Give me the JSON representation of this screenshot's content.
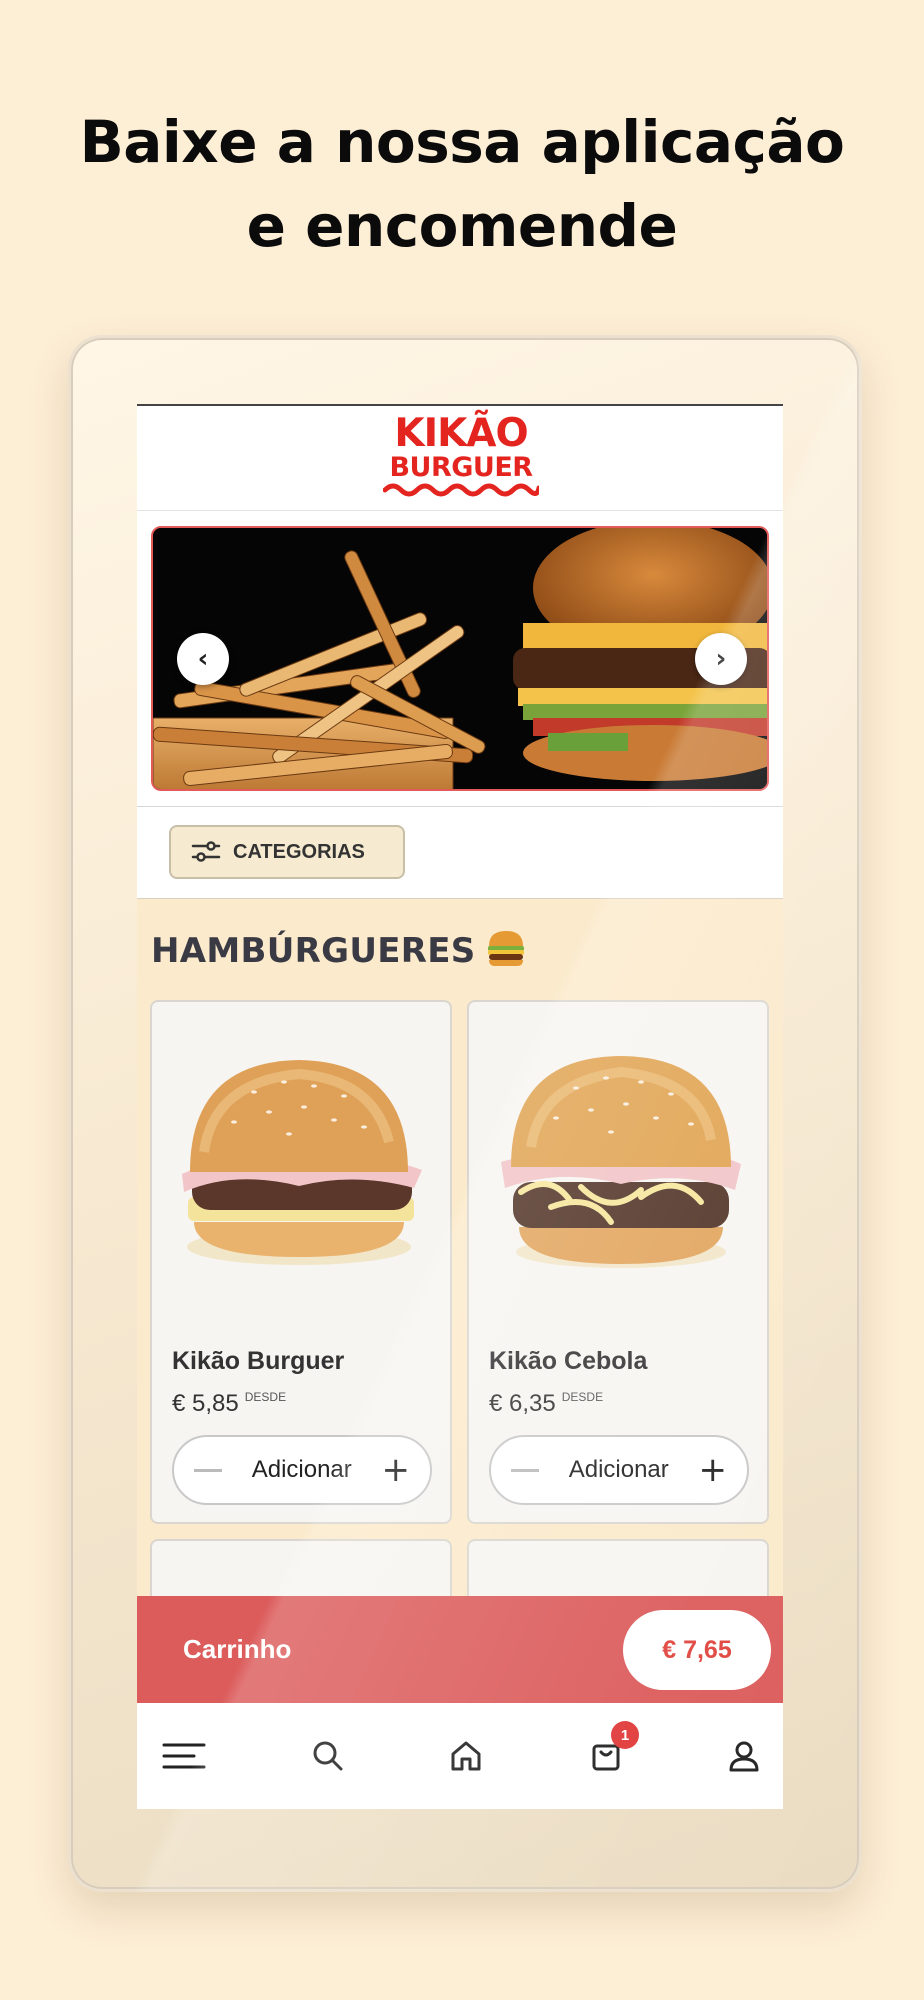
{
  "headline": {
    "line1": "Baixe a nossa aplicação",
    "line2": "e encomende"
  },
  "brand": {
    "logo_line1": "KIKÃO",
    "logo_line2": "BURGUER",
    "color": "#e4241f"
  },
  "banner": {
    "prev_icon": "chevron-left-icon",
    "next_icon": "chevron-right-icon",
    "prev_glyph": "‹",
    "next_glyph": "›"
  },
  "categories_button": {
    "label": "CATEGORIAS",
    "icon": "sliders-icon"
  },
  "section": {
    "title": "HAMBÚRGUERES",
    "emoji_icon": "hamburger-icon"
  },
  "products": [
    {
      "name": "Kikão Burguer",
      "price": "€ 5,85",
      "price_note": "DESDE",
      "add_label": "Adicionar"
    },
    {
      "name": "Kikão Cebola",
      "price": "€ 6,35",
      "price_note": "DESDE",
      "add_label": "Adicionar"
    }
  ],
  "cart": {
    "label": "Carrinho",
    "total": "€ 7,65",
    "color": "#dc5c5c"
  },
  "tabbar": {
    "items": [
      "menu-icon",
      "search-icon",
      "home-icon",
      "cart-icon",
      "user-icon"
    ],
    "cart_badge": "1"
  },
  "colors": {
    "background": "#fdeed6",
    "content_background": "#fbeacb",
    "accent": "#e0463f"
  }
}
